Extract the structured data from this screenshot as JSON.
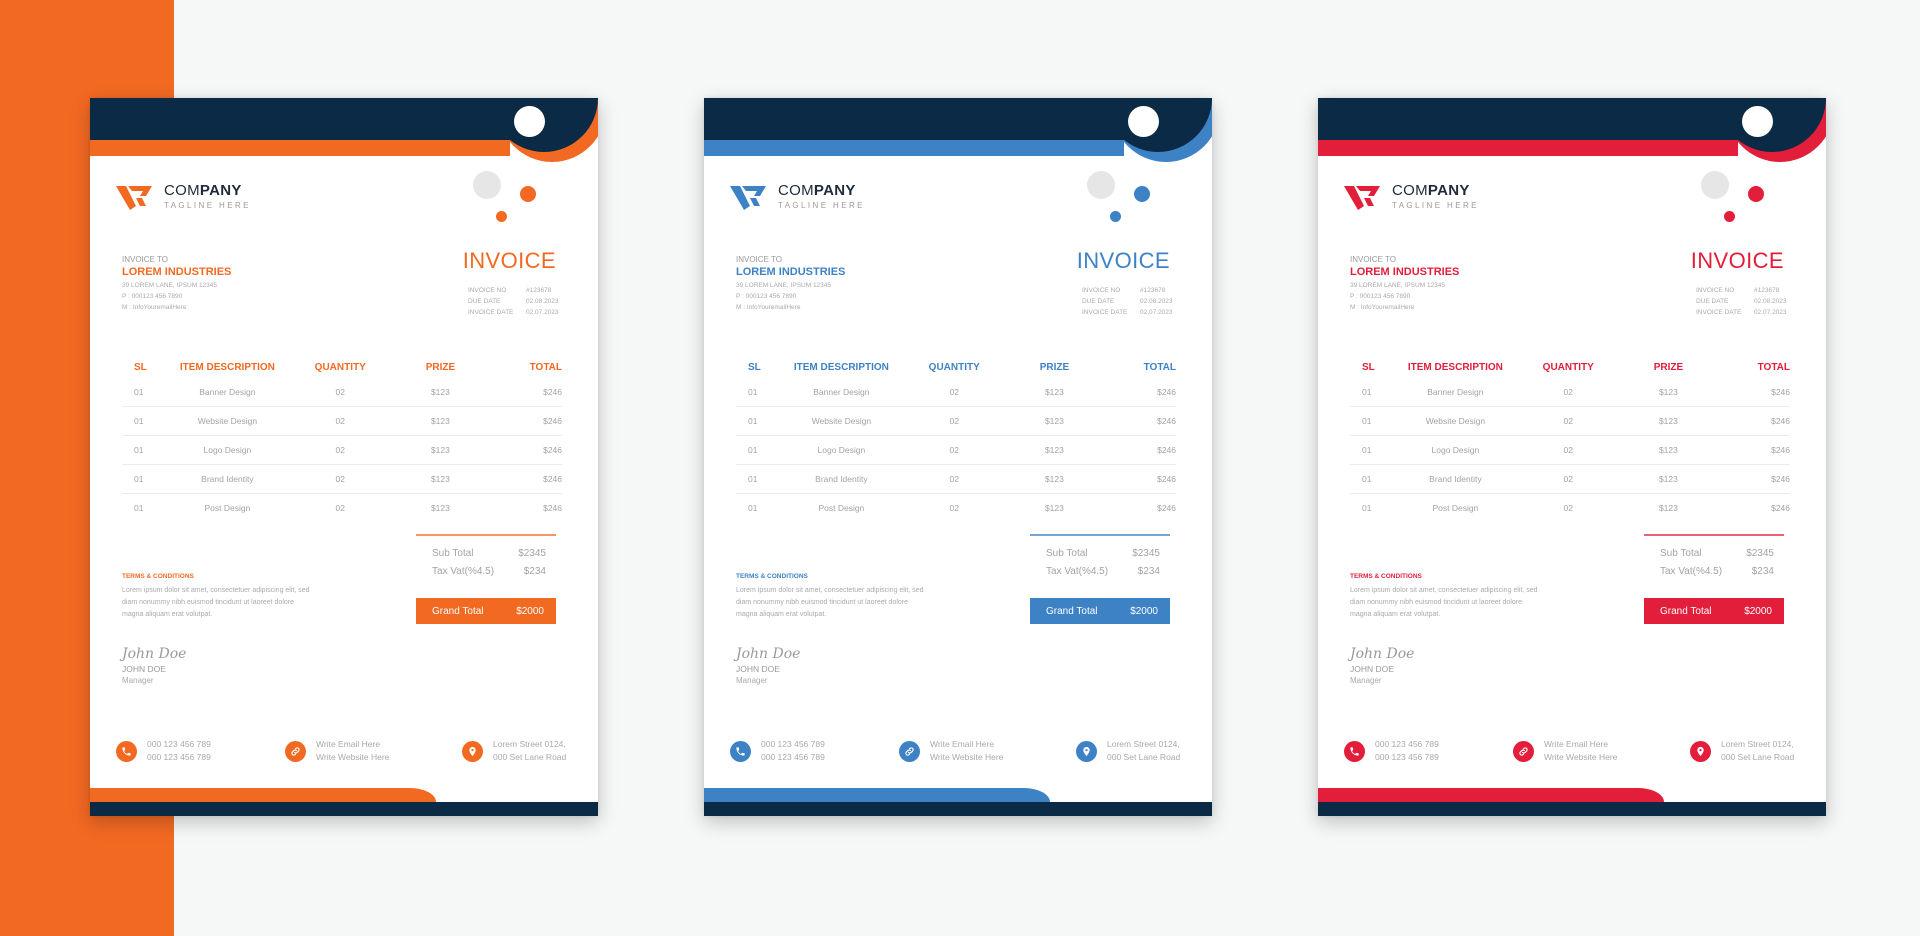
{
  "background": {
    "strip_color": "#f26922",
    "page_bg": "#f6f7f7"
  },
  "common": {
    "dark_color": "#0b2a45",
    "company": {
      "name_light": "COM",
      "name_bold": "PANY",
      "tagline": "TAGLINE HERE"
    },
    "bill_to": {
      "label": "INVOICE TO",
      "client": "LOREM INDUSTRIES",
      "address": "39 LOREM LANE, IPSUM 12345",
      "phone": "P : 000123 456 7890",
      "email": "M : InfoYouremailHere"
    },
    "invoice": {
      "title": "INVOICE",
      "meta": [
        {
          "key": "INVOICE NO",
          "value": "#123678"
        },
        {
          "key": "DUE DATE",
          "value": "02.08.2023"
        },
        {
          "key": "INVOICE DATE",
          "value": "02.07.2023"
        }
      ]
    },
    "table": {
      "headers": [
        "SL",
        "ITEM DESCRIPTION",
        "QUANTITY",
        "PRIZE",
        "TOTAL"
      ],
      "rows": [
        [
          "01",
          "Banner Design",
          "02",
          "$123",
          "$246"
        ],
        [
          "01",
          "Website Design",
          "02",
          "$123",
          "$246"
        ],
        [
          "01",
          "Logo Design",
          "02",
          "$123",
          "$246"
        ],
        [
          "01",
          "Brand Identity",
          "02",
          "$123",
          "$246"
        ],
        [
          "01",
          "Post Design",
          "02",
          "$123",
          "$246"
        ]
      ]
    },
    "totals": {
      "sub_total_label": "Sub Total",
      "sub_total": "$2345",
      "tax_label": "Tax Vat(%4.5)",
      "tax": "$234",
      "grand_label": "Grand Total",
      "grand": "$2000"
    },
    "terms": {
      "title": "TERMS & CONDITIONS",
      "text": "Lorem ipsum dolor sit amet, consectetuer adipiscing elit, sed diam nonummy nibh euismod tincidunt ut laoreet dolore magna aliquam erat volutpat."
    },
    "signature": {
      "script": "John Doe",
      "name": "JOHN DOE",
      "role": "Manager"
    },
    "contacts": [
      {
        "icon": "phone-icon",
        "line1": "000 123 456 789",
        "line2": "000 123 456 789"
      },
      {
        "icon": "link-icon",
        "line1": "Write Email Here",
        "line2": "Write Website Here"
      },
      {
        "icon": "location-pin-icon",
        "line1": "Lorem Street 0124,",
        "line2": "000 Set Lane Road"
      }
    ]
  },
  "variants": [
    {
      "name": "orange",
      "accent": "#f26922"
    },
    {
      "name": "blue",
      "accent": "#3e82c6"
    },
    {
      "name": "red",
      "accent": "#e21e3a"
    }
  ]
}
